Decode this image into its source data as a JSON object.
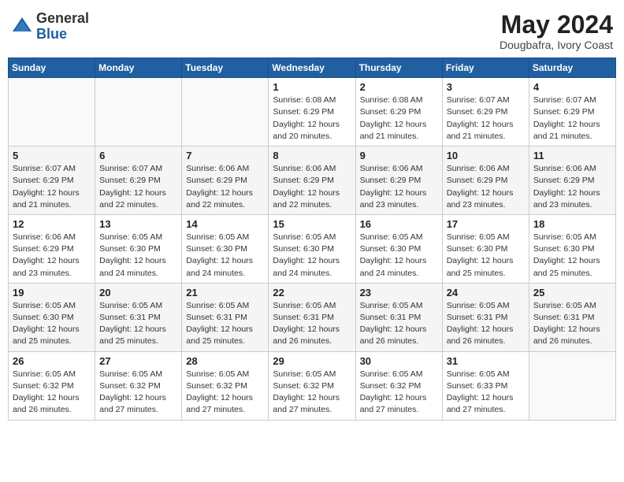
{
  "header": {
    "logo_general": "General",
    "logo_blue": "Blue",
    "month_year": "May 2024",
    "location": "Dougbafra, Ivory Coast"
  },
  "calendar": {
    "days_of_week": [
      "Sunday",
      "Monday",
      "Tuesday",
      "Wednesday",
      "Thursday",
      "Friday",
      "Saturday"
    ],
    "weeks": [
      [
        {
          "day": "",
          "info": ""
        },
        {
          "day": "",
          "info": ""
        },
        {
          "day": "",
          "info": ""
        },
        {
          "day": "1",
          "info": "Sunrise: 6:08 AM\nSunset: 6:29 PM\nDaylight: 12 hours\nand 20 minutes."
        },
        {
          "day": "2",
          "info": "Sunrise: 6:08 AM\nSunset: 6:29 PM\nDaylight: 12 hours\nand 21 minutes."
        },
        {
          "day": "3",
          "info": "Sunrise: 6:07 AM\nSunset: 6:29 PM\nDaylight: 12 hours\nand 21 minutes."
        },
        {
          "day": "4",
          "info": "Sunrise: 6:07 AM\nSunset: 6:29 PM\nDaylight: 12 hours\nand 21 minutes."
        }
      ],
      [
        {
          "day": "5",
          "info": "Sunrise: 6:07 AM\nSunset: 6:29 PM\nDaylight: 12 hours\nand 21 minutes."
        },
        {
          "day": "6",
          "info": "Sunrise: 6:07 AM\nSunset: 6:29 PM\nDaylight: 12 hours\nand 22 minutes."
        },
        {
          "day": "7",
          "info": "Sunrise: 6:06 AM\nSunset: 6:29 PM\nDaylight: 12 hours\nand 22 minutes."
        },
        {
          "day": "8",
          "info": "Sunrise: 6:06 AM\nSunset: 6:29 PM\nDaylight: 12 hours\nand 22 minutes."
        },
        {
          "day": "9",
          "info": "Sunrise: 6:06 AM\nSunset: 6:29 PM\nDaylight: 12 hours\nand 23 minutes."
        },
        {
          "day": "10",
          "info": "Sunrise: 6:06 AM\nSunset: 6:29 PM\nDaylight: 12 hours\nand 23 minutes."
        },
        {
          "day": "11",
          "info": "Sunrise: 6:06 AM\nSunset: 6:29 PM\nDaylight: 12 hours\nand 23 minutes."
        }
      ],
      [
        {
          "day": "12",
          "info": "Sunrise: 6:06 AM\nSunset: 6:29 PM\nDaylight: 12 hours\nand 23 minutes."
        },
        {
          "day": "13",
          "info": "Sunrise: 6:05 AM\nSunset: 6:30 PM\nDaylight: 12 hours\nand 24 minutes."
        },
        {
          "day": "14",
          "info": "Sunrise: 6:05 AM\nSunset: 6:30 PM\nDaylight: 12 hours\nand 24 minutes."
        },
        {
          "day": "15",
          "info": "Sunrise: 6:05 AM\nSunset: 6:30 PM\nDaylight: 12 hours\nand 24 minutes."
        },
        {
          "day": "16",
          "info": "Sunrise: 6:05 AM\nSunset: 6:30 PM\nDaylight: 12 hours\nand 24 minutes."
        },
        {
          "day": "17",
          "info": "Sunrise: 6:05 AM\nSunset: 6:30 PM\nDaylight: 12 hours\nand 25 minutes."
        },
        {
          "day": "18",
          "info": "Sunrise: 6:05 AM\nSunset: 6:30 PM\nDaylight: 12 hours\nand 25 minutes."
        }
      ],
      [
        {
          "day": "19",
          "info": "Sunrise: 6:05 AM\nSunset: 6:30 PM\nDaylight: 12 hours\nand 25 minutes."
        },
        {
          "day": "20",
          "info": "Sunrise: 6:05 AM\nSunset: 6:31 PM\nDaylight: 12 hours\nand 25 minutes."
        },
        {
          "day": "21",
          "info": "Sunrise: 6:05 AM\nSunset: 6:31 PM\nDaylight: 12 hours\nand 25 minutes."
        },
        {
          "day": "22",
          "info": "Sunrise: 6:05 AM\nSunset: 6:31 PM\nDaylight: 12 hours\nand 26 minutes."
        },
        {
          "day": "23",
          "info": "Sunrise: 6:05 AM\nSunset: 6:31 PM\nDaylight: 12 hours\nand 26 minutes."
        },
        {
          "day": "24",
          "info": "Sunrise: 6:05 AM\nSunset: 6:31 PM\nDaylight: 12 hours\nand 26 minutes."
        },
        {
          "day": "25",
          "info": "Sunrise: 6:05 AM\nSunset: 6:31 PM\nDaylight: 12 hours\nand 26 minutes."
        }
      ],
      [
        {
          "day": "26",
          "info": "Sunrise: 6:05 AM\nSunset: 6:32 PM\nDaylight: 12 hours\nand 26 minutes."
        },
        {
          "day": "27",
          "info": "Sunrise: 6:05 AM\nSunset: 6:32 PM\nDaylight: 12 hours\nand 27 minutes."
        },
        {
          "day": "28",
          "info": "Sunrise: 6:05 AM\nSunset: 6:32 PM\nDaylight: 12 hours\nand 27 minutes."
        },
        {
          "day": "29",
          "info": "Sunrise: 6:05 AM\nSunset: 6:32 PM\nDaylight: 12 hours\nand 27 minutes."
        },
        {
          "day": "30",
          "info": "Sunrise: 6:05 AM\nSunset: 6:32 PM\nDaylight: 12 hours\nand 27 minutes."
        },
        {
          "day": "31",
          "info": "Sunrise: 6:05 AM\nSunset: 6:33 PM\nDaylight: 12 hours\nand 27 minutes."
        },
        {
          "day": "",
          "info": ""
        }
      ]
    ]
  }
}
